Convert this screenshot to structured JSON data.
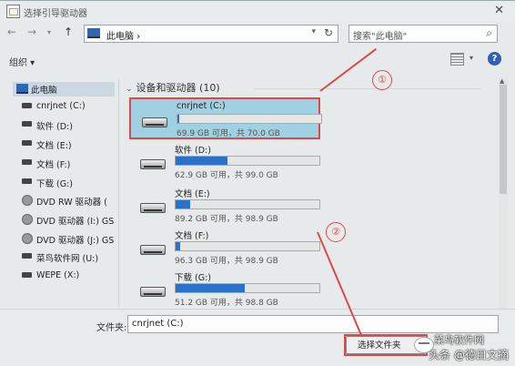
{
  "window": {
    "title": "选择引导驱动器"
  },
  "address_bar": {
    "path": "此电脑",
    "separator": "›"
  },
  "search": {
    "placeholder": "搜索\"此电脑\""
  },
  "toolbar": {
    "organize_label": "组织 ▾"
  },
  "sidebar": {
    "items": [
      {
        "label": "此电脑",
        "icon": "pc-icon",
        "selected": true
      },
      {
        "label": "cnrjnet (C:)",
        "icon": "drive-icon"
      },
      {
        "label": "软件 (D:)",
        "icon": "drive-icon"
      },
      {
        "label": "文档 (E:)",
        "icon": "drive-icon"
      },
      {
        "label": "文档 (F:)",
        "icon": "drive-icon"
      },
      {
        "label": "下载 (G:)",
        "icon": "drive-icon"
      },
      {
        "label": "DVD RW 驱动器 (",
        "icon": "disc-icon"
      },
      {
        "label": "DVD 驱动器 (I:) GS",
        "icon": "disc-icon"
      },
      {
        "label": "DVD 驱动器 (J:) GS",
        "icon": "disc-icon"
      },
      {
        "label": "菜鸟软件网 (U:)",
        "icon": "drive-icon"
      },
      {
        "label": "WEPE (X:)",
        "icon": "drive-icon"
      }
    ]
  },
  "main": {
    "group_header": "设备和驱动器 (10)",
    "drives": [
      {
        "name": "cnrjnet (C:)",
        "info": "69.9 GB 可用，共 70.0 GB",
        "used_fraction": 0.01,
        "selected": true
      },
      {
        "name": "软件 (D:)",
        "info": "62.9 GB 可用，共 99.0 GB",
        "used_fraction": 0.36
      },
      {
        "name": "文档 (E:)",
        "info": "89.2 GB 可用，共 98.9 GB",
        "used_fraction": 0.1
      },
      {
        "name": "文档 (F:)",
        "info": "96.3 GB 可用，共 98.9 GB",
        "used_fraction": 0.03
      },
      {
        "name": "下载 (G:)",
        "info": "51.2 GB 可用，共 98.8 GB",
        "used_fraction": 0.48
      }
    ]
  },
  "footer": {
    "folder_label": "文件夹:",
    "folder_value": "cnrjnet (C:)",
    "select_button": "选择文件夹"
  },
  "annotations": {
    "marker_1": "①",
    "marker_2": "②",
    "color": "#e0474c"
  },
  "watermark": {
    "top": "菜鸟软件网",
    "bottom": "头条 @德目文摘"
  }
}
